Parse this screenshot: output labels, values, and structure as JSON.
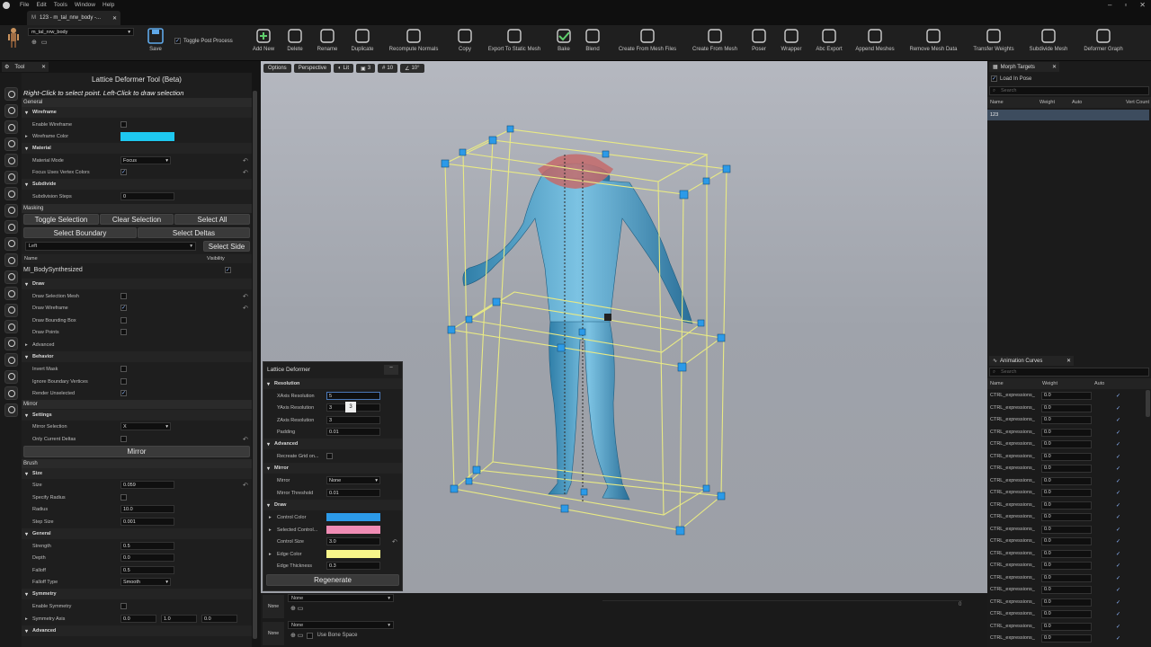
{
  "menu": [
    "File",
    "Edit",
    "Tools",
    "Window",
    "Help"
  ],
  "doc_tab": "123 - m_tal_nrw_body -...",
  "asset_selector": "m_tal_nrw_body",
  "toggle_post_process": "Toggle Post Process",
  "toolbar": {
    "save": "Save",
    "items": [
      "Add New",
      "Delete",
      "Rename",
      "Duplicate",
      "Recompute Normals",
      "Copy",
      "Export To Static Mesh",
      "Bake",
      "Blend",
      "Create From Mesh Files",
      "Create From Mesh",
      "Poser",
      "Wrapper",
      "Abc Export",
      "Append Meshes",
      "Remove Mesh Data",
      "Transfer Weights",
      "Subdivide Mesh",
      "Deformer Graph"
    ]
  },
  "tool_tab": "Tool",
  "tool": {
    "title": "Lattice Deformer Tool (Beta)",
    "hint": "Right-Click to select point. Left-Click to draw selection",
    "general": "General",
    "wireframe": "Wireframe",
    "enable_wireframe": "Enable Wireframe",
    "wireframe_color": "Wireframe Color",
    "material": "Material",
    "material_mode": "Material Mode",
    "material_mode_val": "Focus",
    "focus_vertex": "Focus Uses Vertex Colors",
    "subdivide": "Subdivide",
    "subdivision_steps": "Subdivision Steps",
    "subdivision_val": "0",
    "masking": "Masking",
    "toggle_selection": "Toggle Selection",
    "clear_selection": "Clear Selection",
    "select_all": "Select All",
    "select_boundary": "Select Boundary",
    "select_deltas": "Select Deltas",
    "side_val": "Left",
    "select_side": "Select Side",
    "name_col": "Name",
    "visibility_col": "Visibility",
    "mat_name": "MI_BodySynthesized",
    "draw": "Draw",
    "draw_sel_mesh": "Draw Selection Mesh",
    "draw_wire": "Draw Wireframe",
    "draw_bbox": "Draw Bounding Box",
    "draw_points": "Draw Points",
    "advanced": "Advanced",
    "behavior": "Behavior",
    "invert_mask": "Invert Mask",
    "ignore_boundary": "Ignore Boundary Vertices",
    "render_unselected": "Render Unselected",
    "mirror": "Mirror",
    "settings": "Settings",
    "mirror_selection": "Mirror Selection",
    "mirror_sel_val": "X",
    "only_current": "Only Current Deltas",
    "mirror_btn": "Mirror",
    "brush": "Brush",
    "size": "Size",
    "size_val": "0.059",
    "specify_radius": "Specify Radius",
    "radius": "Radius",
    "radius_val": "10.0",
    "step_size": "Step Size",
    "step_val": "0.001",
    "general2": "General",
    "strength": "Strength",
    "strength_val": "0.5",
    "depth": "Depth",
    "depth_val": "0.0",
    "falloff": "Falloff",
    "falloff_val": "0.5",
    "falloff_type": "Falloff Type",
    "falloff_type_val": "Smooth",
    "symmetry": "Symmetry",
    "enable_symmetry": "Enable Symmetry",
    "symmetry_axis": "Symmetry Axis",
    "axis": [
      "0.0",
      "1.0",
      "0.0"
    ],
    "advanced2": "Advanced"
  },
  "viewport_buttons": [
    "Options",
    "Perspective",
    "Lit",
    "3",
    "10",
    "10°"
  ],
  "lattice": {
    "title": "Lattice Deformer",
    "resolution": "Resolution",
    "x_res": "XAxis Resolution",
    "x_val": "5",
    "y_res": "YAxis Resolution",
    "y_val": "3",
    "y_tip": "3",
    "z_res": "ZAxis Resolution",
    "z_val": "3",
    "padding": "Padding",
    "padding_val": "0.01",
    "advanced": "Advanced",
    "recreate": "Recreate Grid on...",
    "mirror": "Mirror",
    "mirror_lab": "Mirror",
    "mirror_val": "None",
    "mirror_threshold": "Mirror Threshold",
    "mirror_threshold_val": "0.01",
    "draw": "Draw",
    "control_color": "Control Color",
    "selected_control": "Selected Control...",
    "control_size": "Control Size",
    "control_size_val": "3.0",
    "edge_color": "Edge Color",
    "edge_thickness": "Edge Thickness",
    "edge_thickness_val": "0.3",
    "regenerate": "Regenerate"
  },
  "timeline": {
    "none_label": "None",
    "dropdown1": "None",
    "dropdown2": "None",
    "use_bone_space": "Use Bone Space",
    "counter": "0"
  },
  "morph": {
    "tab": "Morph Targets",
    "load_in_pose": "Load In Pose",
    "search": "Search",
    "cols": [
      "Name",
      "Weight",
      "Auto",
      "Vert Count"
    ],
    "row": "123"
  },
  "curves": {
    "tab": "Animation Curves",
    "search": "Search",
    "cols": [
      "Name",
      "Weight",
      "Auto"
    ],
    "name": "CTRL_expressions_",
    "weight": "0.0",
    "count": 21
  },
  "colors": {
    "wireframe": "#1ec8f0",
    "control": "#2c9ae8",
    "selected": "#f08cb4",
    "edge": "#f7f58a",
    "lattice": "#e9ea84"
  }
}
